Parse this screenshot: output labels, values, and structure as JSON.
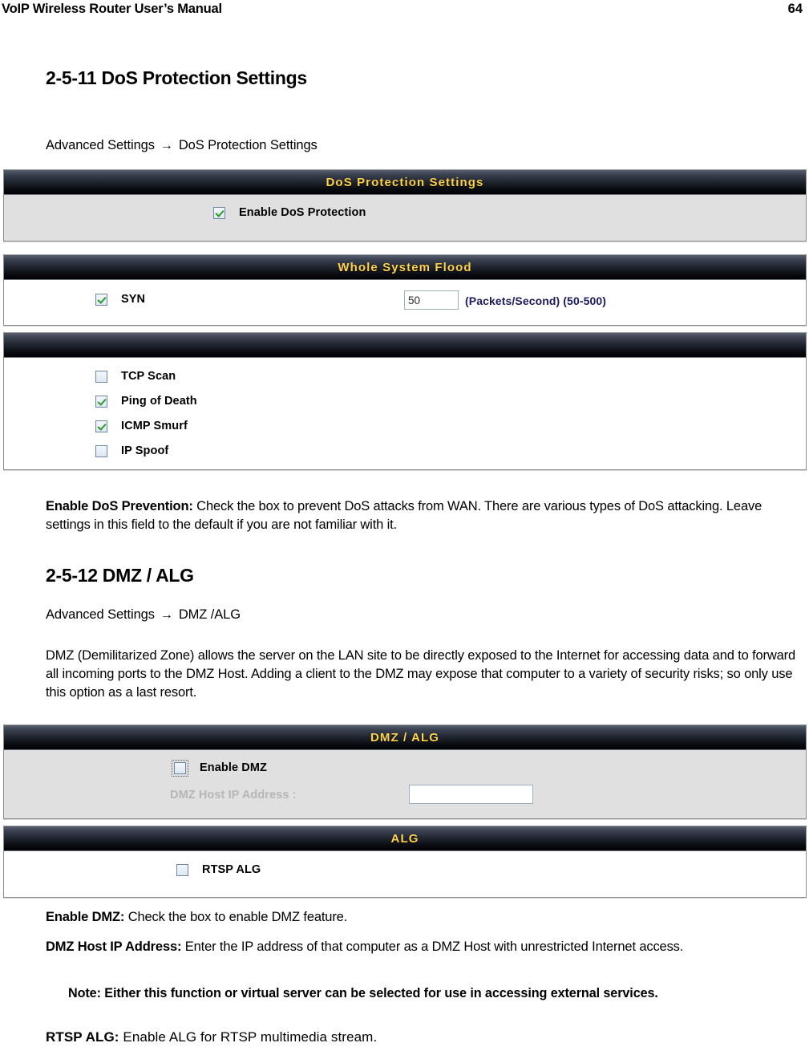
{
  "page": {
    "doc_title": "VoIP Wireless Router User’s Manual",
    "page_number": "64"
  },
  "sections": [
    {
      "heading": "2-5-11 DoS Protection Settings",
      "breadcrumb_root": "Advanced Settings",
      "breadcrumb_arrow": "→",
      "breadcrumb_leaf": "DoS Protection Settings"
    },
    {
      "heading": "2-5-12 DMZ / ALG",
      "breadcrumb_root": "Advanced Settings",
      "breadcrumb_arrow": "→",
      "breadcrumb_leaf": "DMZ /ALG"
    }
  ],
  "dos_panel": {
    "title": "DoS Protection Settings",
    "enable_label": "Enable DoS Protection",
    "enable_checked": true
  },
  "flood_panel": {
    "title": "Whole System Flood",
    "syn_label": "SYN",
    "syn_checked": true,
    "syn_value": "50",
    "syn_units": "(Packets/Second) (50-500)"
  },
  "attack_panel": {
    "title": "",
    "items": [
      {
        "label": "TCP Scan",
        "checked": false
      },
      {
        "label": "Ping of Death",
        "checked": true
      },
      {
        "label": "ICMP Smurf",
        "checked": true
      },
      {
        "label": "IP Spoof",
        "checked": false
      }
    ]
  },
  "dmz_panel": {
    "title": "DMZ / ALG",
    "enable_label": "Enable DMZ",
    "enable_checked": false,
    "host_ip_label": "DMZ Host IP Address :",
    "host_ip_value": "",
    "host_ip_placeholder": ""
  },
  "alg_panel": {
    "title": "ALG",
    "rtsp_label": "RTSP ALG",
    "rtsp_checked": false
  },
  "descriptions": {
    "dos_term": "Enable DoS Prevention:",
    "dos_body": " Check the box to prevent DoS attacks from WAN. There are various types of DoS attacking. Leave settings in this field to the default if you are not familiar with it.",
    "dmz_intro": "DMZ (Demilitarized Zone) allows the server on the LAN site to be directly exposed to the Internet for accessing data and to forward all incoming ports to the DMZ Host. Adding a client to the DMZ may expose that computer to a variety of security risks; so only use this option as a last resort.",
    "enable_dmz_term": "Enable DMZ:",
    "enable_dmz_body": " Check the box to enable DMZ feature.",
    "host_ip_term": "DMZ Host IP Address:",
    "host_ip_body": " Enter the IP address of that computer as a DMZ Host with unrestricted Internet access.",
    "note": "Note: Either this function or virtual server can be selected for use in accessing external services.",
    "rtsp_term": "RTSP ALG:",
    "rtsp_body": " Enable ALG for RTSP multimedia stream."
  },
  "colors": {
    "panel_title": "#ffd24a",
    "check_mark": "#2a9a2a",
    "unit_text": "#1a1a5e"
  }
}
